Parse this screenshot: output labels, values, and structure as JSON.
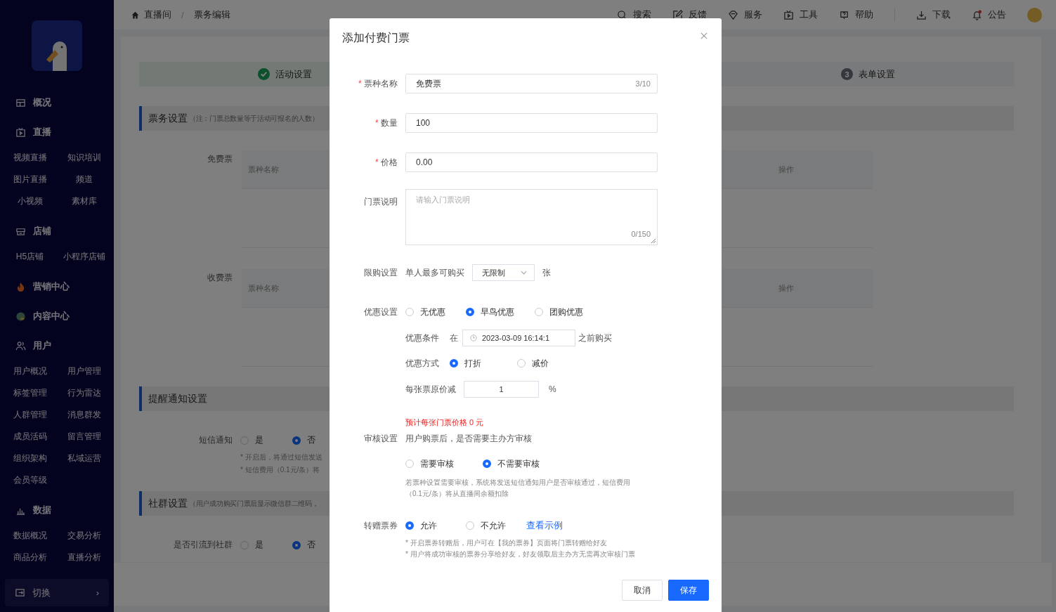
{
  "sidebar": {
    "groups": [
      {
        "label": "概况",
        "kind": "overview"
      },
      {
        "label": "直播",
        "kind": "live",
        "children": [
          "视频直播",
          "知识培训",
          "图片直播",
          "频道",
          "小视频",
          "素材库"
        ]
      },
      {
        "label": "店铺",
        "kind": "shop",
        "children": [
          "H5店铺",
          "小程序店铺"
        ]
      },
      {
        "label": "营销中心",
        "kind": "fire"
      },
      {
        "label": "内容中心",
        "kind": "content"
      },
      {
        "label": "用户",
        "kind": "users",
        "children": [
          "用户概况",
          "用户管理",
          "标签管理",
          "行为雷达",
          "人群管理",
          "消息群发",
          "成员活码",
          "留言管理",
          "组织架构",
          "私域运营",
          "会员等级"
        ]
      },
      {
        "label": "数据",
        "kind": "data",
        "children": [
          "数据概况",
          "交易分析",
          "商品分析",
          "直播分析"
        ]
      }
    ],
    "switch": {
      "label": "切换",
      "arrow": "›"
    }
  },
  "breadcrumb": {
    "items": [
      "直播间",
      "票务编辑"
    ],
    "separator": "/"
  },
  "toolbar": [
    {
      "label": "搜索",
      "kind": "search",
      "dot": false
    },
    {
      "label": "反馈",
      "kind": "edit",
      "dot": false
    },
    {
      "label": "服务",
      "kind": "service",
      "dot": false
    },
    {
      "label": "工具",
      "kind": "live",
      "dot": false
    },
    {
      "label": "帮助",
      "kind": "help",
      "dot": false
    },
    {
      "label": "下载",
      "kind": "download",
      "dot": false
    },
    {
      "label": "公告",
      "kind": "bell",
      "dot": true
    }
  ],
  "steps": [
    {
      "label": "活动设置",
      "kind": "done"
    },
    {
      "label": "表单设置",
      "kind": "todo",
      "number": "3"
    }
  ],
  "sections": [
    {
      "title": "票务设置",
      "note": "（注：门票总数量等于活动可报名的人数）",
      "tables": [
        {
          "label": "免费票",
          "columns": [
            "票种名称",
            "操作"
          ]
        },
        {
          "label": "收费票",
          "columns": [
            "票种名称",
            "操作"
          ]
        }
      ]
    },
    {
      "title": "提醒通知设置",
      "fields": [
        {
          "label": "短信通知",
          "options": [
            {
              "label": "是",
              "selected": false
            },
            {
              "label": "否",
              "selected": true
            }
          ]
        }
      ],
      "notes": [
        "* 开启后，将通过短信发送",
        "* 短信费用（0.1元/条）将"
      ]
    },
    {
      "title": "社群设置",
      "note": "（用户成功购买门票后显示微信群二维码，",
      "fields": [
        {
          "label": "是否引流到社群",
          "options": [
            {
              "label": "是",
              "selected": false
            },
            {
              "label": "否",
              "selected": true
            }
          ]
        }
      ]
    }
  ],
  "modal": {
    "title": "添加付费门票",
    "inputs": [
      {
        "label": "票种名称",
        "required_mark": "*",
        "value": "免费票",
        "counter": "3/10"
      },
      {
        "label": "数量",
        "required_mark": "*",
        "value": "100"
      },
      {
        "label": "价格",
        "required_mark": "*",
        "value": "0.00"
      }
    ],
    "description": {
      "label": "门票说明",
      "placeholder": "请输入门票说明",
      "counter": "0/150"
    },
    "limit": {
      "label": "限购设置",
      "prefix": "单人最多可购买",
      "value": "无限制",
      "suffix": "张"
    },
    "discount": {
      "label": "优惠设置",
      "options": [
        {
          "label": "无优惠",
          "selected": false
        },
        {
          "label": "早鸟优惠",
          "selected": true
        },
        {
          "label": "团购优惠",
          "selected": false
        }
      ],
      "condition": {
        "label": "优惠条件",
        "prefix": "在",
        "value": "2023-03-09 16:14:1",
        "suffix": "之前购买"
      },
      "method": {
        "label": "优惠方式",
        "options": [
          {
            "label": "打折",
            "selected": true
          },
          {
            "label": "减价",
            "selected": false
          }
        ]
      },
      "amount": {
        "label": "每张票原价减",
        "value": "1",
        "suffix": "%"
      },
      "estimate": "预计每张门票价格 0 元"
    },
    "review": {
      "label": "审核设置",
      "question": "用户购票后，是否需要主办方审核",
      "options": [
        {
          "label": "需要审核",
          "selected": false
        },
        {
          "label": "不需要审核",
          "selected": true
        }
      ],
      "hint": "若票种设置需要审核，系统将发送短信通知用户是否审核通过，短信费用（0.1元/条）将从直播间余额扣除"
    },
    "transfer": {
      "label": "转赠票券",
      "options": [
        {
          "label": "允许",
          "selected": true
        },
        {
          "label": "不允许",
          "selected": false
        }
      ],
      "link": "查看示例",
      "notes": [
        "* 开启票券转赠后，用户可在【我的票券】页面将门票转赠给好友",
        "* 用户将成功审核的票券分享给好友，好友领取后主办方无需再次审核门票"
      ]
    },
    "buttons": [
      {
        "label": "取消",
        "kind": "secondary"
      },
      {
        "label": "保存",
        "kind": "primary"
      }
    ]
  }
}
